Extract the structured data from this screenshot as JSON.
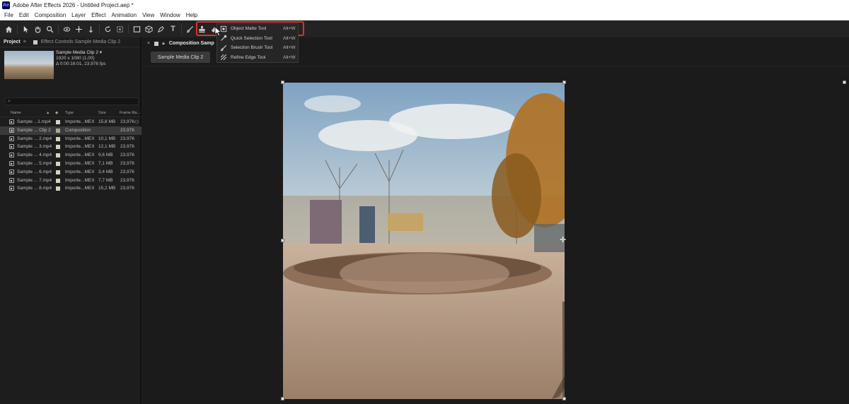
{
  "window": {
    "title": "Adobe After Effects 2026 - Untitled Project.aep *",
    "logo": "Ae"
  },
  "menu": [
    "File",
    "Edit",
    "Composition",
    "Layer",
    "Effect",
    "Animation",
    "View",
    "Window",
    "Help"
  ],
  "toolbar": {
    "tools": [
      "home-icon",
      "selection-tool-icon",
      "hand-tool-icon",
      "zoom-tool-icon",
      "orbit-camera-icon",
      "pan-camera-icon",
      "dolly-camera-icon",
      "rotate-tool-icon",
      "anchor-point-icon",
      "rectangle-tool-icon",
      "extrude-3d-icon",
      "pen-tool-icon",
      "type-tool-icon",
      "brush-tool-icon",
      "clone-stamp-icon",
      "eraser-icon",
      "object-matte-tool-icon"
    ],
    "active_tool": "object-matte-tool-icon",
    "flyout": [
      {
        "icon": "object-matte-icon",
        "label": "Object Matte Tool",
        "shortcut": "Alt+W"
      },
      {
        "icon": "quick-selection-icon",
        "label": "Quick Selection Tool",
        "shortcut": "Alt+W"
      },
      {
        "icon": "selection-brush-icon",
        "label": "Selection Brush Tool",
        "shortcut": "Alt+W"
      },
      {
        "icon": "refine-edge-icon",
        "label": "Refine Edge Tool",
        "shortcut": "Alt+W"
      }
    ]
  },
  "project_panel": {
    "tab_project": "Project",
    "tab_effects": "Effect Controls Sample Media Clip 2",
    "preview": {
      "name": "Sample Media Clip 2",
      "dims": "1920 x 1080 (1,00)",
      "duration": "Δ 0:00:16:01, 23,976 fps"
    },
    "search_placeholder": "",
    "columns": {
      "name": "Name",
      "type": "Type",
      "size": "Size",
      "frame_rate": "Frame Ra..."
    },
    "items": [
      {
        "name": "Sample ...1.mp4",
        "type": "Importe...MEX",
        "size": "15,8 MB",
        "fps": "23,976",
        "kind": "footage"
      },
      {
        "name": "Sample ... Clip 2",
        "type": "Composition",
        "size": "",
        "fps": "23,976",
        "kind": "composition"
      },
      {
        "name": "Sample ... 2.mp4",
        "type": "Importe...MEX",
        "size": "10,1 MB",
        "fps": "23,976",
        "kind": "footage"
      },
      {
        "name": "Sample ... 3.mp4",
        "type": "Importe...MEX",
        "size": "12,1 MB",
        "fps": "23,976",
        "kind": "footage"
      },
      {
        "name": "Sample ... 4.mp4",
        "type": "Importe...MEX",
        "size": "9,6 MB",
        "fps": "23,976",
        "kind": "footage"
      },
      {
        "name": "Sample ... 5.mp4",
        "type": "Importe...MEX",
        "size": "7,1 MB",
        "fps": "23,976",
        "kind": "footage"
      },
      {
        "name": "Sample ... 6.mp4",
        "type": "Importe...MEX",
        "size": "3,4 MB",
        "fps": "23,976",
        "kind": "footage"
      },
      {
        "name": "Sample ... 7.mp4",
        "type": "Importe...MEX",
        "size": "7,7 MB",
        "fps": "23,976",
        "kind": "footage"
      },
      {
        "name": "Sample ... 8.mp4",
        "type": "Importe...MEX",
        "size": "15,2 MB",
        "fps": "23,976",
        "kind": "footage"
      }
    ]
  },
  "composition_panel": {
    "tab_title": "Composition Samp",
    "subtab": "Sample Media Clip 2"
  }
}
